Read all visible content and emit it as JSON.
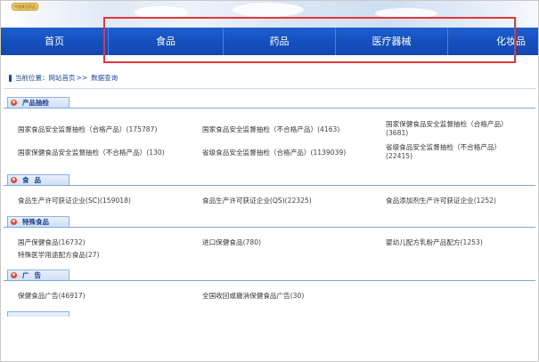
{
  "banner": {
    "logo_text": "中国食品药品"
  },
  "nav": {
    "items": [
      {
        "label": "首页"
      },
      {
        "label": "食品"
      },
      {
        "label": "药品"
      },
      {
        "label": "医疗器械"
      },
      {
        "label": "化妆品"
      }
    ]
  },
  "breadcrumb": {
    "prefix": "当前位置：",
    "home": "网站首页",
    "sep": ">>",
    "current": "数据查询"
  },
  "sections": {
    "product_sampling": {
      "title": "产品抽检",
      "items": [
        {
          "label": "国家食品安全监督抽检（合格产品）",
          "count": "(175787)"
        },
        {
          "label": "国家食品安全监督抽检（不合格产品）",
          "count": "(4163)"
        },
        {
          "label": "国家保健食品安全监督抽检（合格产品）",
          "count": "(3681)"
        },
        {
          "label": "国家保健食品安全监督抽检（不合格产品）",
          "count": "(130)"
        },
        {
          "label": "省级食品安全监督抽检（合格产品）",
          "count": "(1139039)"
        },
        {
          "label": "省级食品安全监督抽检（不合格产品）",
          "count": "(22415)"
        }
      ]
    },
    "food": {
      "title": "食品",
      "items": [
        {
          "label": "食品生产许可获证企业(SC)",
          "count": "(159018)"
        },
        {
          "label": "食品生产许可获证企业(QS)",
          "count": "(22325)"
        },
        {
          "label": "食品添加剂生产许可获证企业",
          "count": "(1252)"
        }
      ]
    },
    "special_food": {
      "title": "特殊食品",
      "items": [
        {
          "label": "国产保健食品",
          "count": "(16732)"
        },
        {
          "label": "进口保健食品",
          "count": "(780)"
        },
        {
          "label": "婴幼儿配方乳粉产品配方",
          "count": "(1253)"
        },
        {
          "label": "特殊医学用途配方食品",
          "count": "(27)"
        }
      ]
    },
    "ads": {
      "title": "广告",
      "items": [
        {
          "label": "保健食品广告",
          "count": "(46917)"
        },
        {
          "label": "全国收回或撤消保健食品广告",
          "count": "(30)"
        }
      ]
    }
  },
  "colors": {
    "nav_blue": "#1550bf",
    "highlight_red": "#e0363c",
    "section_icon": "#e2462b"
  }
}
